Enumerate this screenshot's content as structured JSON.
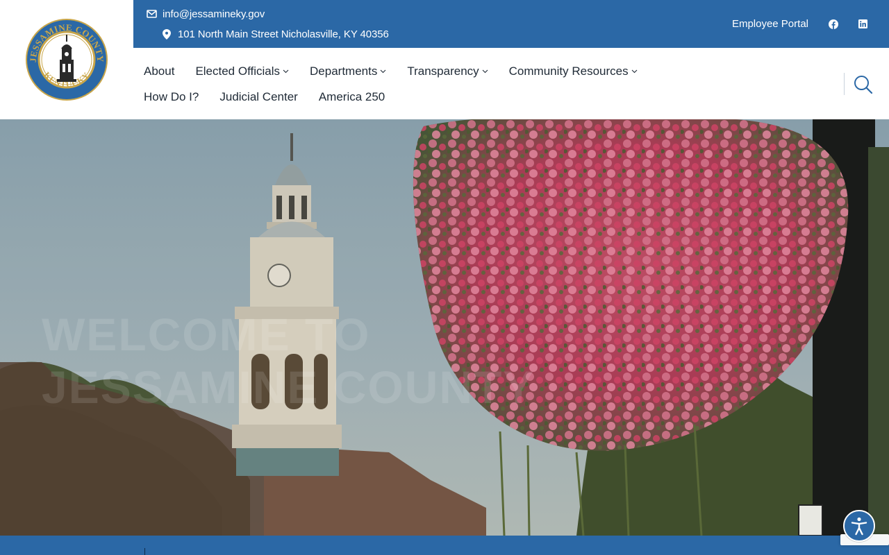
{
  "header": {
    "logo": {
      "alt": "Jessamine County Kentucky seal",
      "arc_top": "JESSAMINE COUNTY",
      "arc_bottom": "KENTUCKY"
    },
    "contact": {
      "email": "info@jessamineky.gov",
      "address": "101 North Main Street Nicholasville, KY 40356"
    },
    "employee_portal": "Employee Portal",
    "social": [
      {
        "icon": "facebook-icon"
      },
      {
        "icon": "linkedin-icon"
      }
    ]
  },
  "nav": {
    "row1": [
      {
        "label": "About",
        "dropdown": false
      },
      {
        "label": "Elected Officials",
        "dropdown": true
      },
      {
        "label": "Departments",
        "dropdown": true
      },
      {
        "label": "Transparency",
        "dropdown": true
      },
      {
        "label": "Community Resources",
        "dropdown": true
      }
    ],
    "row2": [
      {
        "label": "How Do I?",
        "dropdown": false
      },
      {
        "label": "Judicial Center",
        "dropdown": false
      },
      {
        "label": "America 250",
        "dropdown": false
      }
    ],
    "search_icon": "search-icon"
  },
  "hero": {
    "welcome_line1": "Welcome to",
    "welcome_line2": "Jessamine County"
  },
  "colors": {
    "brand_blue": "#2b68a6",
    "nav_text": "#1f2a36"
  }
}
